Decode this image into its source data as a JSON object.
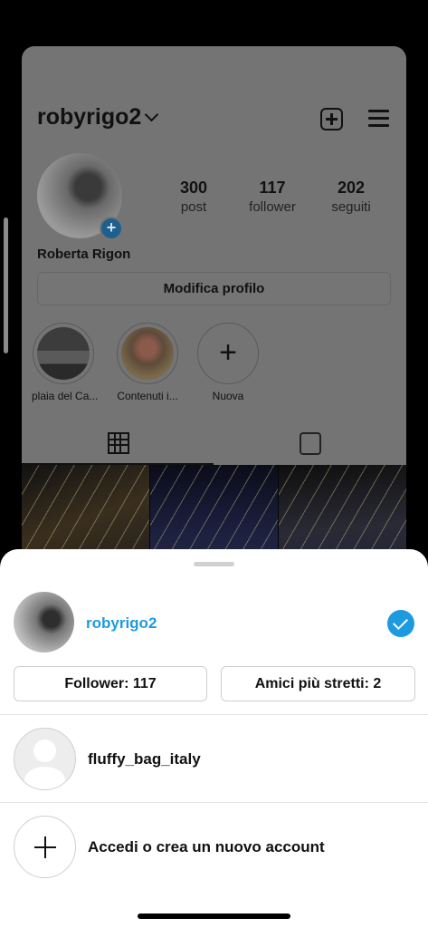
{
  "profile": {
    "username": "robyrigo2",
    "full_name": "Roberta Rigon",
    "stats": [
      {
        "value": "300",
        "label": "post"
      },
      {
        "value": "117",
        "label": "follower"
      },
      {
        "value": "202",
        "label": "seguiti"
      }
    ],
    "edit_button": "Modifica profilo",
    "highlights": [
      {
        "label": "plaia del Ca..."
      },
      {
        "label": "Contenuti i..."
      },
      {
        "label": "Nuova"
      }
    ]
  },
  "sheet": {
    "current_account": {
      "username": "robyrigo2",
      "followers_button": "Follower: 117",
      "close_friends_button": "Amici più stretti: 2"
    },
    "other_account": {
      "username": "fluffy_bag_italy"
    },
    "add_account_label": "Accedi o crea un nuovo account"
  },
  "colors": {
    "accent": "#1e9ae0",
    "overlay": "#747474"
  }
}
